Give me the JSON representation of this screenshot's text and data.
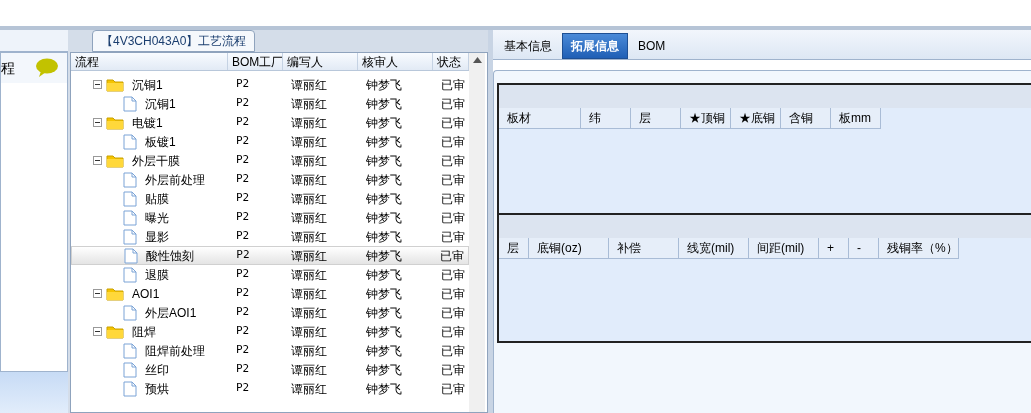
{
  "left_panel": {
    "title": "程"
  },
  "process_tab": {
    "label": "【4V3CH043A0】工艺流程"
  },
  "grid": {
    "columns": [
      "流程",
      "BOM工厂",
      "编写人",
      "核审人",
      "状态"
    ],
    "rows": [
      {
        "name": "沉铜1",
        "kind": "folder",
        "expanded": true,
        "selected": false,
        "bom": "P2",
        "writer": "谭丽红",
        "reviewer": "钟梦飞",
        "status": "已审",
        "children": [
          {
            "name": "沉铜1",
            "kind": "step",
            "selected": false,
            "bom": "P2",
            "writer": "谭丽红",
            "reviewer": "钟梦飞",
            "status": "已审"
          }
        ]
      },
      {
        "name": "电镀1",
        "kind": "folder",
        "expanded": true,
        "selected": false,
        "bom": "P2",
        "writer": "谭丽红",
        "reviewer": "钟梦飞",
        "status": "已审",
        "children": [
          {
            "name": "板镀1",
            "kind": "step",
            "selected": false,
            "bom": "P2",
            "writer": "谭丽红",
            "reviewer": "钟梦飞",
            "status": "已审"
          }
        ]
      },
      {
        "name": "外层干膜",
        "kind": "folder",
        "expanded": true,
        "selected": false,
        "bom": "P2",
        "writer": "谭丽红",
        "reviewer": "钟梦飞",
        "status": "已审",
        "children": [
          {
            "name": "外层前处理",
            "kind": "step",
            "selected": false,
            "bom": "P2",
            "writer": "谭丽红",
            "reviewer": "钟梦飞",
            "status": "已审"
          },
          {
            "name": "贴膜",
            "kind": "step",
            "selected": false,
            "bom": "P2",
            "writer": "谭丽红",
            "reviewer": "钟梦飞",
            "status": "已审"
          },
          {
            "name": "曝光",
            "kind": "step",
            "selected": false,
            "bom": "P2",
            "writer": "谭丽红",
            "reviewer": "钟梦飞",
            "status": "已审"
          },
          {
            "name": "显影",
            "kind": "step",
            "selected": false,
            "bom": "P2",
            "writer": "谭丽红",
            "reviewer": "钟梦飞",
            "status": "已审"
          },
          {
            "name": "酸性蚀刻",
            "kind": "step",
            "selected": true,
            "bom": "P2",
            "writer": "谭丽红",
            "reviewer": "钟梦飞",
            "status": "已审"
          },
          {
            "name": "退膜",
            "kind": "step",
            "selected": false,
            "bom": "P2",
            "writer": "谭丽红",
            "reviewer": "钟梦飞",
            "status": "已审"
          }
        ]
      },
      {
        "name": "AOI1",
        "kind": "folder",
        "expanded": true,
        "selected": false,
        "bom": "P2",
        "writer": "谭丽红",
        "reviewer": "钟梦飞",
        "status": "已审",
        "children": [
          {
            "name": "外层AOI1",
            "kind": "step",
            "selected": false,
            "bom": "P2",
            "writer": "谭丽红",
            "reviewer": "钟梦飞",
            "status": "已审"
          }
        ]
      },
      {
        "name": "阻焊",
        "kind": "folder",
        "expanded": true,
        "selected": false,
        "bom": "P2",
        "writer": "谭丽红",
        "reviewer": "钟梦飞",
        "status": "已审",
        "children": [
          {
            "name": "阻焊前处理",
            "kind": "step",
            "selected": false,
            "bom": "P2",
            "writer": "谭丽红",
            "reviewer": "钟梦飞",
            "status": "已审"
          },
          {
            "name": "丝印",
            "kind": "step",
            "selected": false,
            "bom": "P2",
            "writer": "谭丽红",
            "reviewer": "钟梦飞",
            "status": "已审"
          },
          {
            "name": "预烘",
            "kind": "step",
            "selected": false,
            "bom": "P2",
            "writer": "谭丽红",
            "reviewer": "钟梦飞",
            "status": "已审"
          }
        ]
      }
    ]
  },
  "tabs": [
    {
      "label": "基本信息",
      "selected": false
    },
    {
      "label": "拓展信息",
      "selected": true
    },
    {
      "label": "BOM",
      "selected": false
    }
  ],
  "board_table": {
    "columns": [
      "板材",
      "纬",
      "层",
      "★顶铜",
      "★底铜",
      "含铜",
      "板mm"
    ]
  },
  "layer_table": {
    "columns": [
      "层",
      "底铜(oz)",
      "补偿",
      "线宽(mil)",
      "间距(mil)",
      "+",
      "-",
      "残铜率（%）"
    ]
  }
}
